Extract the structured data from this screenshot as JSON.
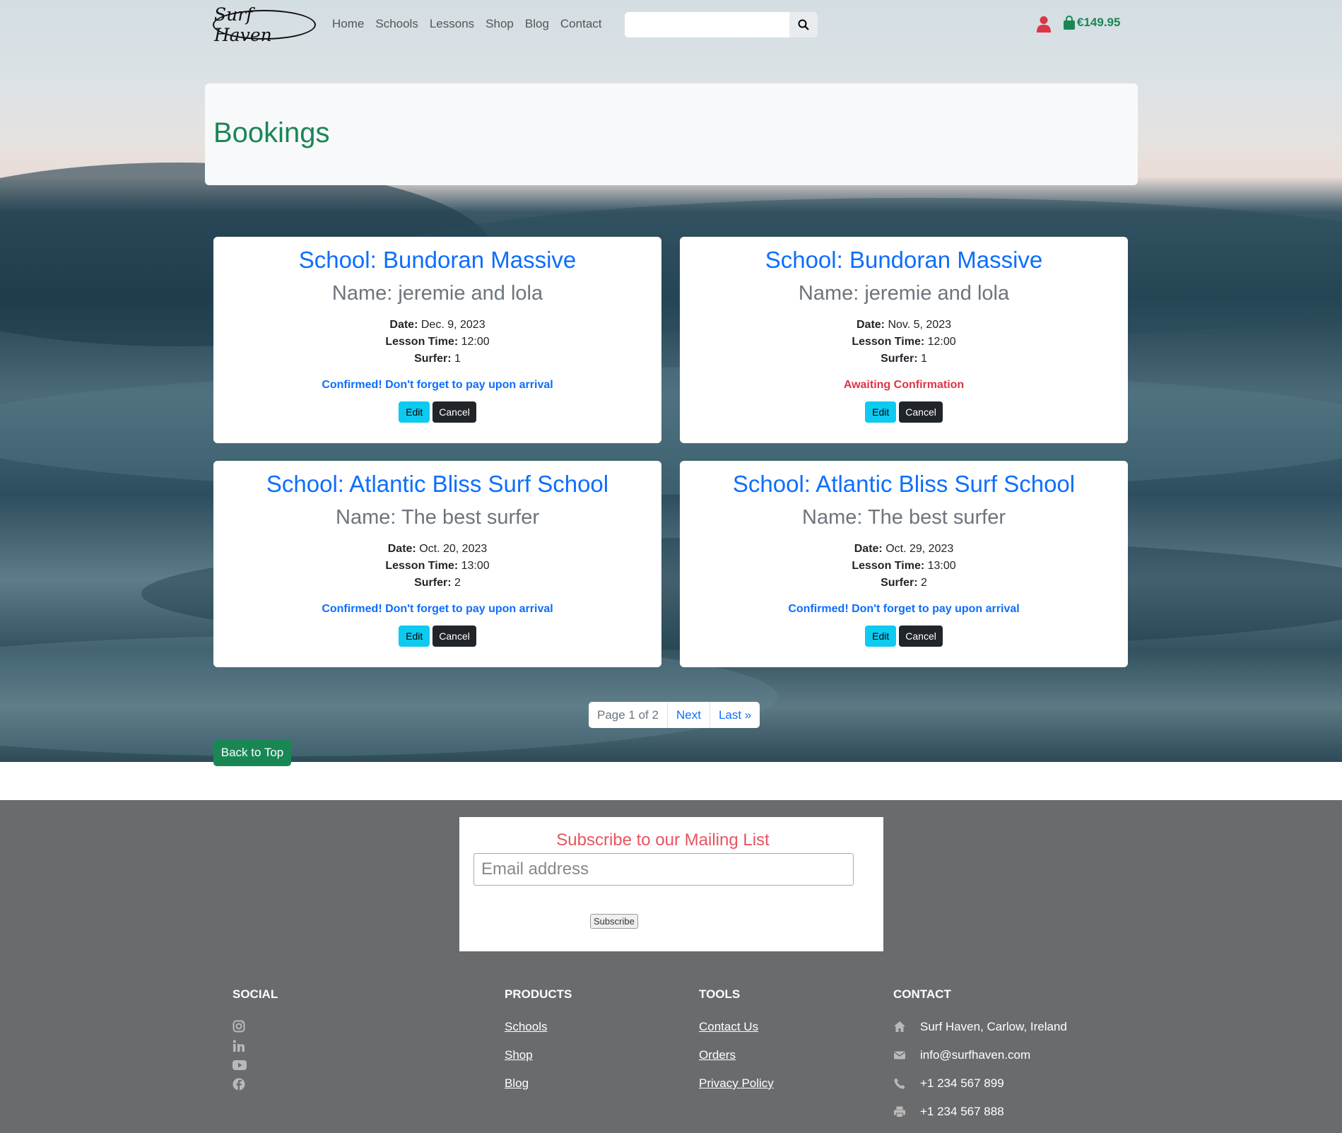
{
  "brand": {
    "logo_text": "Surf Haven"
  },
  "nav": {
    "items": [
      "Home",
      "Schools",
      "Lessons",
      "Shop",
      "Blog",
      "Contact"
    ]
  },
  "search": {
    "placeholder": ""
  },
  "cart": {
    "total": "€149.95"
  },
  "page": {
    "title": "Bookings"
  },
  "bookings": [
    {
      "school": "School: Bundoran Massive",
      "name": "Name: jeremie and lola",
      "date_label": "Date:",
      "date": "Dec. 9, 2023",
      "time_label": "Lesson Time:",
      "time": "12:00",
      "surfer_label": "Surfer:",
      "surfer": "1",
      "status": "Confirmed! Don't forget to pay upon arrival",
      "status_type": "confirmed",
      "edit": "Edit",
      "cancel": "Cancel"
    },
    {
      "school": "School: Bundoran Massive",
      "name": "Name: jeremie and lola",
      "date_label": "Date:",
      "date": "Nov. 5, 2023",
      "time_label": "Lesson Time:",
      "time": "12:00",
      "surfer_label": "Surfer:",
      "surfer": "1",
      "status": "Awaiting Confirmation",
      "status_type": "awaiting",
      "edit": "Edit",
      "cancel": "Cancel"
    },
    {
      "school": "School: Atlantic Bliss Surf School",
      "name": "Name: The best surfer",
      "date_label": "Date:",
      "date": "Oct. 20, 2023",
      "time_label": "Lesson Time:",
      "time": "13:00",
      "surfer_label": "Surfer:",
      "surfer": "2",
      "status": "Confirmed! Don't forget to pay upon arrival",
      "status_type": "confirmed",
      "edit": "Edit",
      "cancel": "Cancel"
    },
    {
      "school": "School: Atlantic Bliss Surf School",
      "name": "Name: The best surfer",
      "date_label": "Date:",
      "date": "Oct. 29, 2023",
      "time_label": "Lesson Time:",
      "time": "13:00",
      "surfer_label": "Surfer:",
      "surfer": "2",
      "status": "Confirmed! Don't forget to pay upon arrival",
      "status_type": "confirmed",
      "edit": "Edit",
      "cancel": "Cancel"
    }
  ],
  "pagination": {
    "current": "Page 1 of 2",
    "next": "Next",
    "last": "Last »"
  },
  "back_to_top": "Back to Top",
  "newsletter": {
    "title": "Subscribe to our Mailing List",
    "placeholder": "Email address",
    "button": "Subscribe"
  },
  "footer": {
    "social": {
      "heading": "Social",
      "icons": [
        "instagram-icon",
        "linkedin-icon",
        "youtube-icon",
        "facebook-icon"
      ]
    },
    "products": {
      "heading": "Products",
      "links": [
        "Schools",
        "Shop",
        "Blog"
      ]
    },
    "tools": {
      "heading": "Tools",
      "links": [
        "Contact Us",
        "Orders",
        "Privacy Policy"
      ]
    },
    "contact": {
      "heading": "Contact",
      "address": "Surf Haven, Carlow, Ireland",
      "email": "info@surfhaven.com",
      "phone": "+1 234 567 899",
      "fax": "+1 234 567 888"
    }
  },
  "colors": {
    "brand_green": "#198754",
    "link_blue": "#0d6efd",
    "danger_red": "#dc3545",
    "info_cyan": "#0dcaf0",
    "footer_gray": "#6a6b6d",
    "newsletter_red": "#e8545f"
  }
}
